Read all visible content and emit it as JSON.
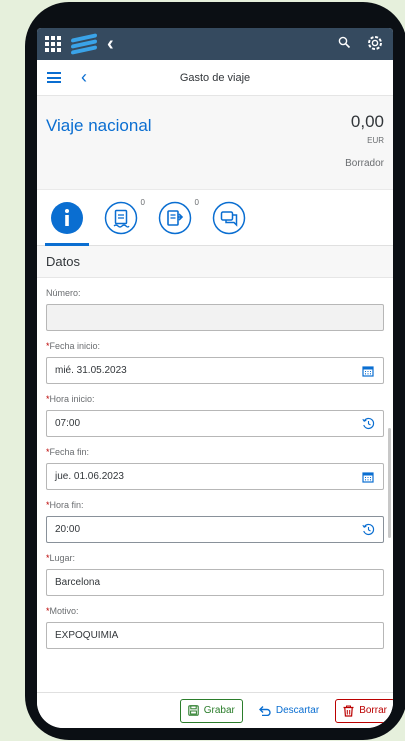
{
  "shell": {
    "icons": [
      "grid-icon",
      "sap-logo",
      "back-icon",
      "search-icon",
      "settings-icon"
    ]
  },
  "header": {
    "title": "Gasto de viaje"
  },
  "object": {
    "title": "Viaje nacional",
    "amount": "0,00",
    "currency": "EUR",
    "status": "Borrador"
  },
  "tabs": [
    {
      "name": "info",
      "count": ""
    },
    {
      "name": "receipts",
      "count": "0"
    },
    {
      "name": "per-diem",
      "count": "0"
    },
    {
      "name": "comments",
      "count": ""
    }
  ],
  "section": {
    "title": "Datos"
  },
  "fields": {
    "numero": {
      "label": "Número:",
      "value": ""
    },
    "fecha_inicio": {
      "label": "Fecha inicio:",
      "value": "mié. 31.05.2023"
    },
    "hora_inicio": {
      "label": "Hora inicio:",
      "value": "07:00"
    },
    "fecha_fin": {
      "label": "Fecha fin:",
      "value": "jue. 01.06.2023"
    },
    "hora_fin": {
      "label": "Hora fin:",
      "value": "20:00"
    },
    "lugar": {
      "label": "Lugar:",
      "value": "Barcelona"
    },
    "motivo": {
      "label": "Motivo:",
      "value": "EXPOQUIMIA"
    }
  },
  "required_marker": "*",
  "footer": {
    "save": "Grabar",
    "discard": "Descartar",
    "delete": "Borrar"
  },
  "colors": {
    "shell": "#354a5f",
    "accent": "#0a6ed1",
    "save": "#2b7d2b",
    "delete": "#bb0000"
  }
}
